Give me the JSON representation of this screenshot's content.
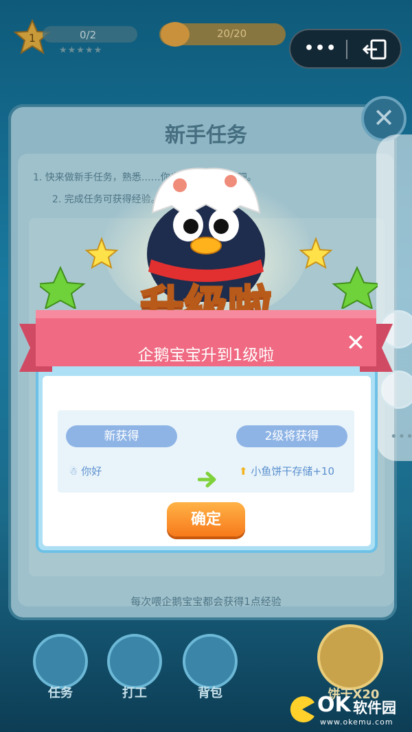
{
  "hud": {
    "level_number": "1",
    "level_progress": "0/2",
    "level_stars": "★★★★★",
    "coin_value": "20/20"
  },
  "capsule": {
    "more_label": "•••"
  },
  "background_card": {
    "title": "新手任务",
    "line1": "1. 快来做新手任务，熟悉……你自己的企鹅宝宝吧。",
    "line2": "2. 完成任务可获得经验。",
    "footer": "每次喂企鹅宝宝都会获得1点经验"
  },
  "levelup": {
    "headline": "升级啦",
    "subtitle": "企鹅宝宝升到1级啦",
    "close_label": "✕",
    "new_gain_label": "新获得",
    "next_gain_label": "2级将获得",
    "new_gain_item": "你好",
    "next_gain_item": "小鱼饼干存储+10",
    "confirm_label": "确定"
  },
  "bottom_nav": {
    "items": [
      {
        "label": "任务"
      },
      {
        "label": "打工"
      },
      {
        "label": "背包"
      }
    ],
    "biscuit_label": "饼干X20"
  },
  "watermark": {
    "ok": "OK",
    "site": "软件园",
    "url": "www.okemu.com"
  },
  "colors": {
    "accent_orange": "#f7791a",
    "ribbon_pink": "#ef6a82",
    "pill_blue": "#8eb4e6",
    "headline_yellow": "#ffd64a"
  }
}
